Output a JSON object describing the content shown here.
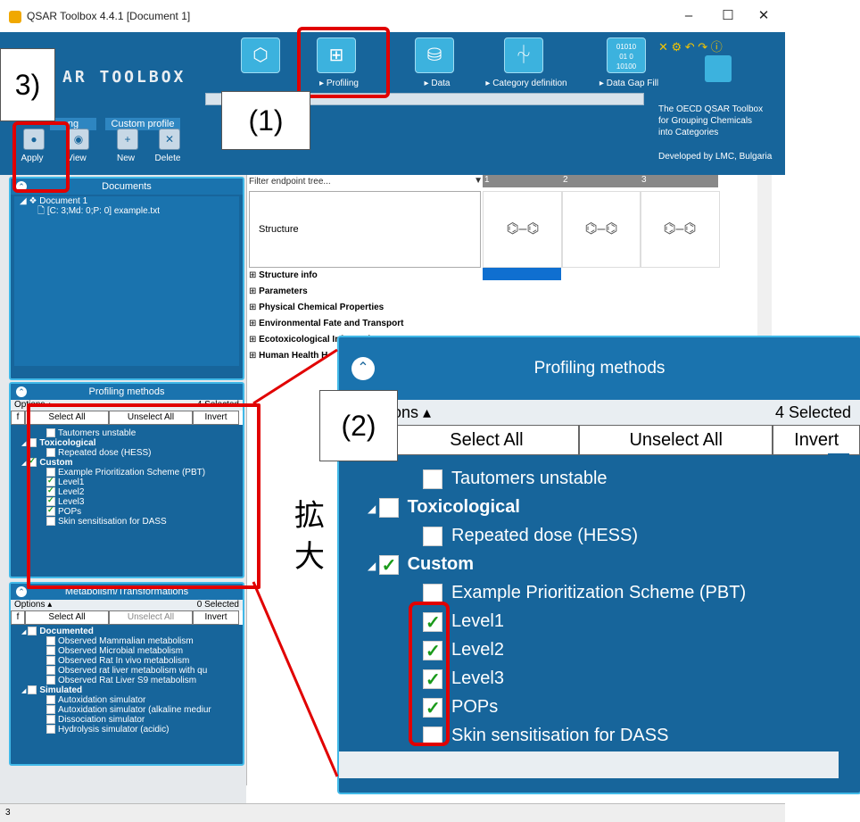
{
  "window": {
    "title": "QSAR Toolbox 4.4.1 [Document 1]",
    "controls": [
      "–",
      "☐",
      "✕"
    ]
  },
  "ribbon": {
    "logo": "AR TOOLBOX",
    "nav": [
      {
        "label": "Profiling",
        "icon": "grid-icon"
      },
      {
        "label": "Data",
        "icon": "database-icon"
      },
      {
        "label": "Category definition",
        "icon": "tree-icon"
      },
      {
        "label": "Data Gap Fill",
        "icon": "binary-icon"
      }
    ],
    "group_labels": {
      "profiling_partial": "ng",
      "custom_profile": "Custom profile"
    },
    "tools": [
      "Apply",
      "View",
      "New",
      "Delete"
    ],
    "info": [
      "The OECD QSAR Toolbox",
      "for Grouping Chemicals",
      "into Categories",
      "Developed by LMC, Bulgaria"
    ]
  },
  "documents_panel": {
    "title": "Documents",
    "items": [
      "Document 1",
      "[C: 3;Md: 0;P: 0] example.txt"
    ]
  },
  "profiling_panel": {
    "title": "Profiling methods",
    "options": "Options ▴",
    "selected": "4 Selected",
    "f": "f",
    "select_all": "Select All",
    "unselect_all": "Unselect All",
    "invert": "Invert",
    "items": [
      {
        "label": "Tautomers unstable",
        "checked": false,
        "bold": false,
        "indent": 2
      },
      {
        "label": "Toxicological",
        "checked": false,
        "bold": true,
        "indent": 1
      },
      {
        "label": "Repeated dose (HESS)",
        "checked": false,
        "bold": false,
        "indent": 2
      },
      {
        "label": "Custom",
        "checked": true,
        "bold": true,
        "indent": 1
      },
      {
        "label": "Example Prioritization Scheme (PBT)",
        "checked": false,
        "bold": false,
        "indent": 2
      },
      {
        "label": "Level1",
        "checked": true,
        "bold": false,
        "indent": 2
      },
      {
        "label": "Level2",
        "checked": true,
        "bold": false,
        "indent": 2
      },
      {
        "label": "Level3",
        "checked": true,
        "bold": false,
        "indent": 2
      },
      {
        "label": "POPs",
        "checked": true,
        "bold": false,
        "indent": 2
      },
      {
        "label": "Skin sensitisation for DASS",
        "checked": false,
        "bold": false,
        "indent": 2
      }
    ]
  },
  "metabolism_panel": {
    "title": "Metabolism/Transformations",
    "options": "Options ▴",
    "selected": "0 Selected",
    "f": "f",
    "select_all": "Select All",
    "unselect_all": "Unselect All",
    "invert": "Invert",
    "items": [
      {
        "label": "Documented",
        "bold": true,
        "indent": 1
      },
      {
        "label": "Observed Mammalian metabolism",
        "bold": false,
        "indent": 2
      },
      {
        "label": "Observed Microbial metabolism",
        "bold": false,
        "indent": 2
      },
      {
        "label": "Observed Rat In vivo metabolism",
        "bold": false,
        "indent": 2
      },
      {
        "label": "Observed rat liver metabolism with qu",
        "bold": false,
        "indent": 2
      },
      {
        "label": "Observed Rat Liver S9  metabolism",
        "bold": false,
        "indent": 2
      },
      {
        "label": "Simulated",
        "bold": true,
        "indent": 1
      },
      {
        "label": "Autoxidation simulator",
        "bold": false,
        "indent": 2
      },
      {
        "label": "Autoxidation simulator (alkaline mediur",
        "bold": false,
        "indent": 2
      },
      {
        "label": "Dissociation simulator",
        "bold": false,
        "indent": 2
      },
      {
        "label": "Hydrolysis simulator (acidic)",
        "bold": false,
        "indent": 2
      }
    ]
  },
  "grid": {
    "filter_placeholder": "Filter endpoint tree...",
    "columns": [
      "1",
      "2",
      "3"
    ],
    "structure_label": "Structure",
    "endpoints": [
      "Structure info",
      "Parameters",
      "Physical Chemical Properties",
      "Environmental Fate and Transport",
      "Ecotoxicological Information",
      "Human Health H"
    ]
  },
  "zoom_overlay": {
    "title": "Profiling methods",
    "options": "ons ▴",
    "selected": "4 Selected",
    "select_all": "Select All",
    "unselect_all": "Unselect All",
    "invert": "Invert",
    "items": [
      {
        "label": "Tautomers unstable",
        "checked": false,
        "bold": false,
        "indent": 2
      },
      {
        "label": "Toxicological",
        "checked": false,
        "bold": true,
        "indent": 1
      },
      {
        "label": "Repeated dose (HESS)",
        "checked": false,
        "bold": false,
        "indent": 2
      },
      {
        "label": "Custom",
        "checked": true,
        "bold": true,
        "indent": 1
      },
      {
        "label": "Example Prioritization Scheme (PBT)",
        "checked": false,
        "bold": false,
        "indent": 2
      },
      {
        "label": "Level1",
        "checked": true,
        "bold": false,
        "indent": 2
      },
      {
        "label": "Level2",
        "checked": true,
        "bold": false,
        "indent": 2
      },
      {
        "label": "Level3",
        "checked": true,
        "bold": false,
        "indent": 2
      },
      {
        "label": "POPs",
        "checked": true,
        "bold": false,
        "indent": 2
      },
      {
        "label": "Skin sensitisation for DASS",
        "checked": false,
        "bold": false,
        "indent": 2
      }
    ]
  },
  "annotations": {
    "step1": "(1)",
    "step2": "(2)",
    "step3": "3)",
    "zoom_text_1": "拡",
    "zoom_text_2": "大"
  },
  "status": {
    "left": "3"
  },
  "colors": {
    "ribbon": "#17659b",
    "accent": "#41b9e8",
    "highlight": "#e10000"
  }
}
